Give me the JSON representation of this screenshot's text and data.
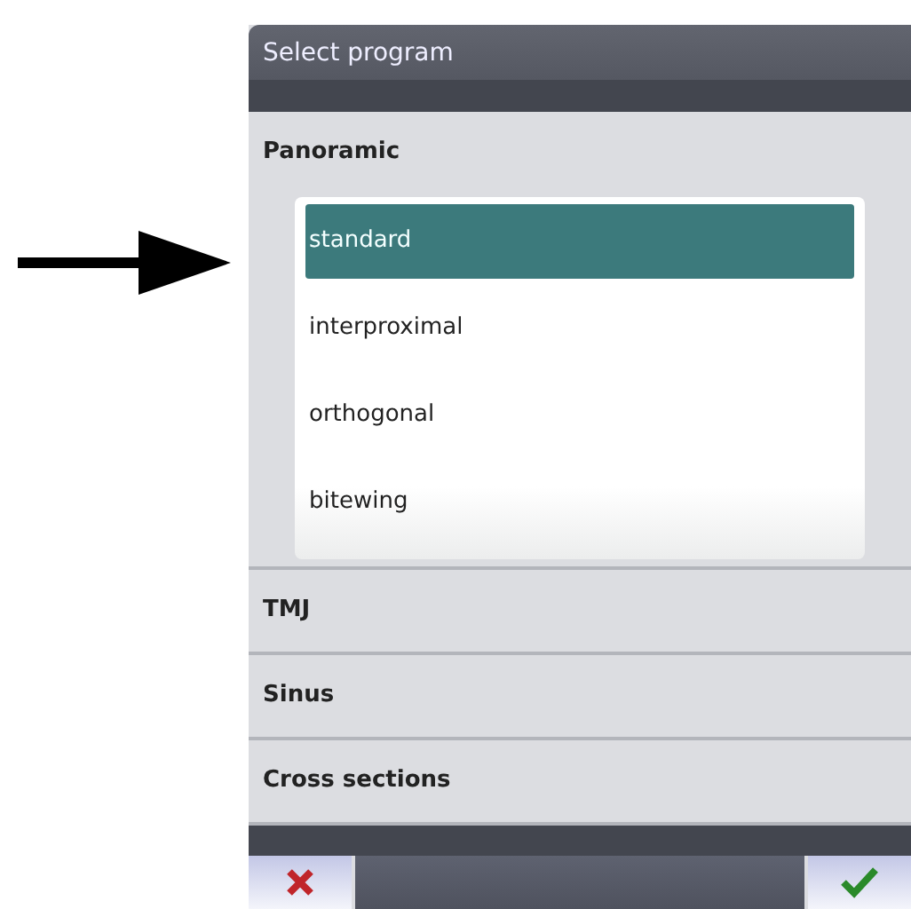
{
  "window": {
    "title": "Select program"
  },
  "categories": [
    {
      "label": "Panoramic",
      "expanded": true,
      "programs": [
        {
          "label": "standard",
          "selected": true
        },
        {
          "label": "interproximal",
          "selected": false
        },
        {
          "label": "orthogonal",
          "selected": false
        },
        {
          "label": "bitewing",
          "selected": false
        }
      ]
    },
    {
      "label": "TMJ",
      "expanded": false
    },
    {
      "label": "Sinus",
      "expanded": false
    },
    {
      "label": "Cross sections",
      "expanded": false
    }
  ]
}
